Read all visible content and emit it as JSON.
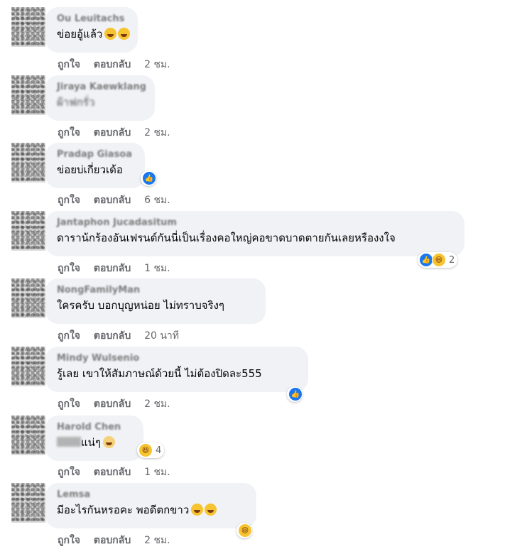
{
  "actions": {
    "like": "ถูกใจ",
    "reply": "ตอบกลับ"
  },
  "comments": [
    {
      "name": "Ou Leuitachs",
      "text": "ข่อยอู้แล้ว",
      "emoji": "rofl-emoji",
      "time": "2 ชม.",
      "reactions": null
    },
    {
      "name": "Jiraya Kaewklang",
      "text": "ผ้าฟกรั่ว",
      "emoji": null,
      "time": "2 ชม.",
      "reactions": null
    },
    {
      "name": "Pradap Giasoa",
      "text": "ข่อยบ่เกี่ยวเด้อ",
      "emoji": null,
      "time": "6 ชม.",
      "reactions": {
        "icons": [
          "like"
        ],
        "count": ""
      }
    },
    {
      "name": "Jantaphon Jucadasitum",
      "text": "ดาราน้กร้องอันเฟรนด์กันนี่เป็นเรื่องคอใหญ่คอขาดบาดตายกันเลยหรืองงใจ",
      "emoji": null,
      "time": "1 ชม.",
      "reactions": {
        "icons": [
          "like",
          "haha"
        ],
        "count": "2"
      }
    },
    {
      "name": "NongFamilyMan",
      "text": "ใครครับ บอกบุญหน่อย ไม่ทราบจริงๆ",
      "emoji": null,
      "time": "20 นาที",
      "reactions": null
    },
    {
      "name": "Mindy Wulsenio",
      "text": "รู้เลย เขาให้สัมภาษณ์ด้วยนี้ ไม่ต้องปิดละ555",
      "emoji": null,
      "time": "2 ชม.",
      "reactions": {
        "icons": [
          "like"
        ],
        "count": ""
      }
    },
    {
      "name": "Harold Chen",
      "text": "แน่ๆ",
      "emoji": "scream-emoji",
      "time": "1 ชม.",
      "reactions": {
        "icons": [
          "haha"
        ],
        "count": "4"
      }
    },
    {
      "name": "Lemsa",
      "text": "มีอะไรกันหรอคะ พอดีตกขาว",
      "emoji": "rofl-emoji",
      "time": "2 ชม.",
      "reactions": {
        "icons": [
          "haha"
        ],
        "count": ""
      }
    }
  ]
}
